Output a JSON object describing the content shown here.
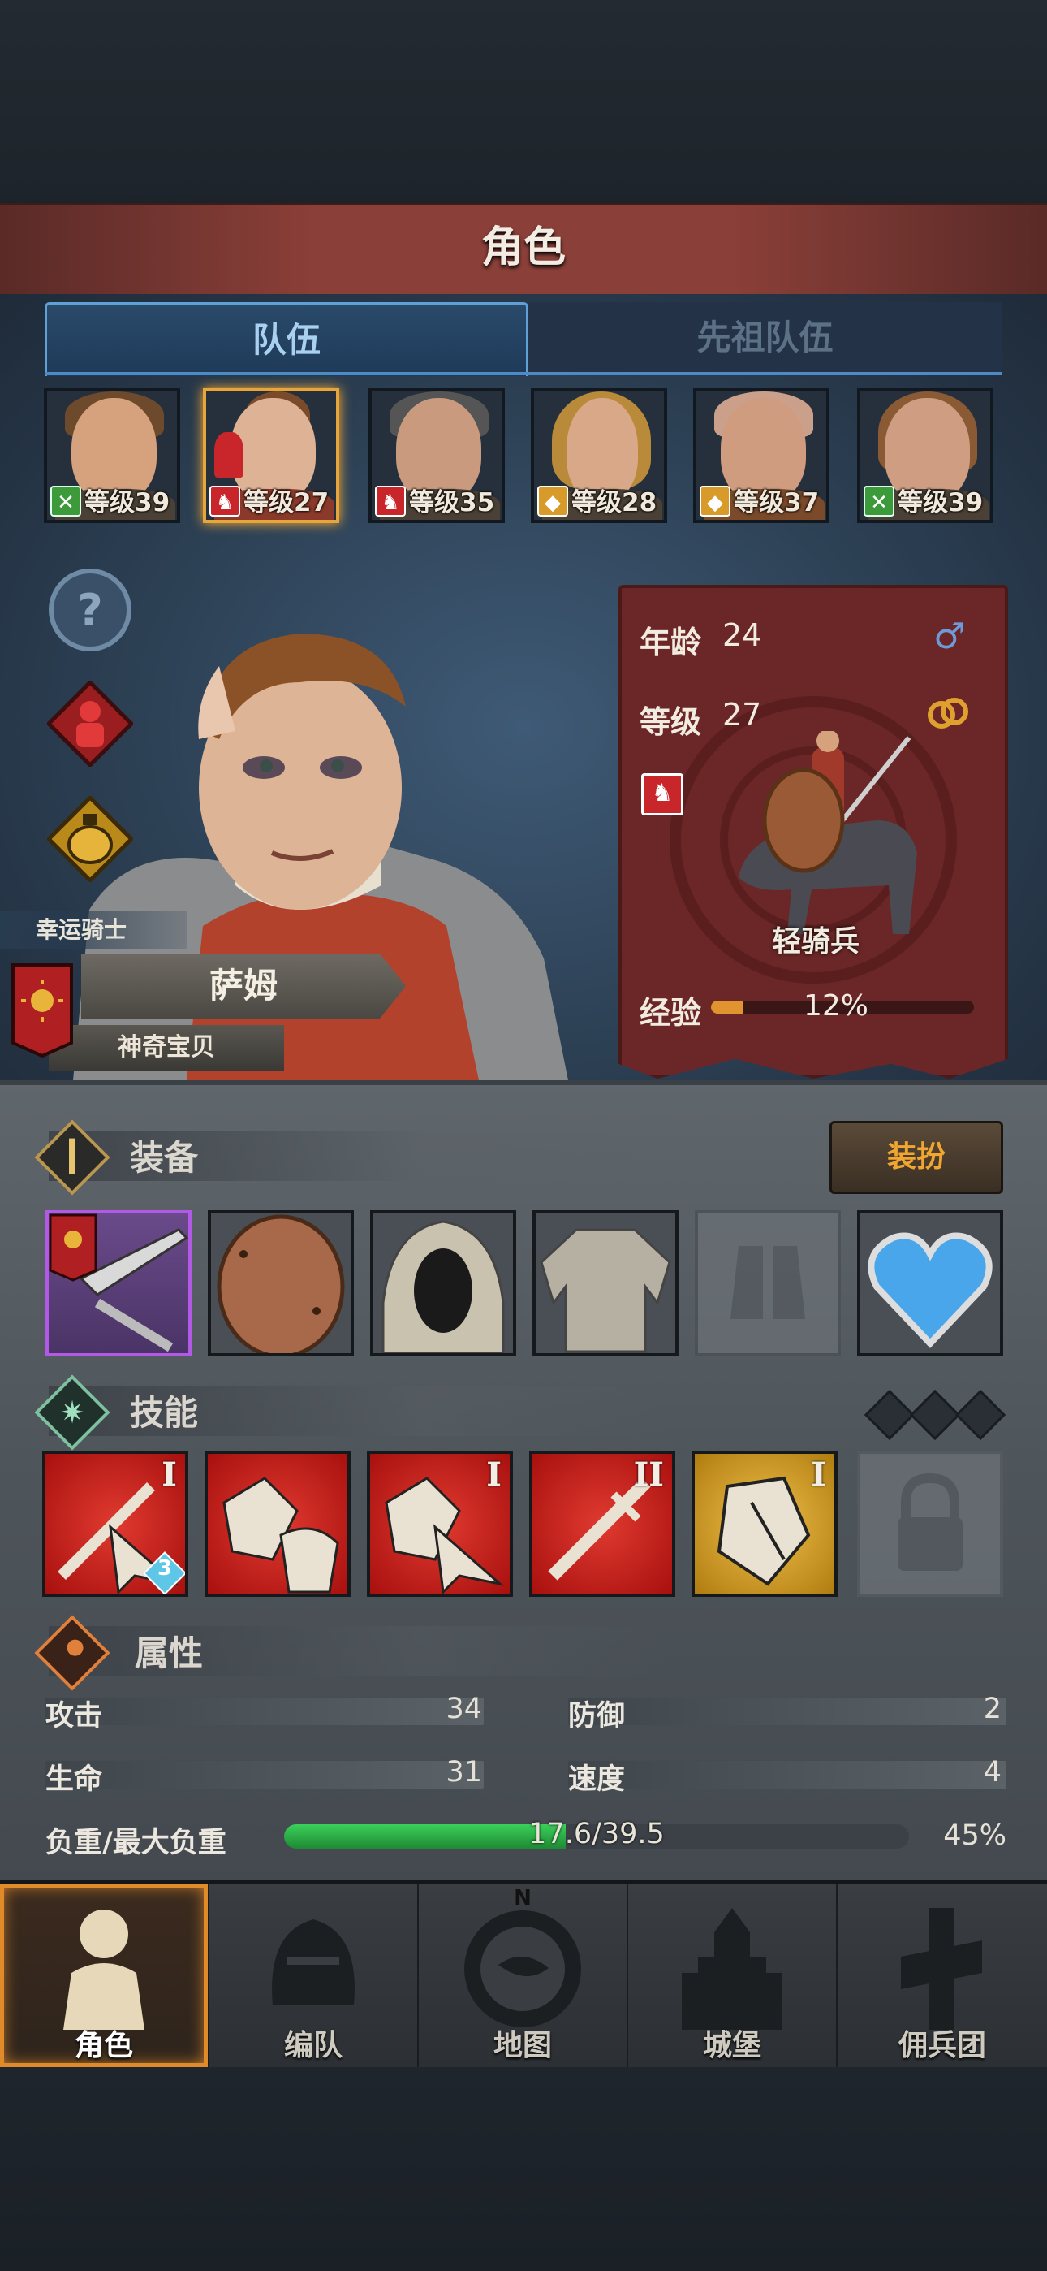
{
  "title": "角色",
  "tabs": [
    {
      "label": "队伍",
      "active": true
    },
    {
      "label": "先祖队伍",
      "active": false
    }
  ],
  "roster": [
    {
      "level_text": "等级39",
      "badge": "archer-icon",
      "hair": "#6e4a2c",
      "skin": "#d6a27e",
      "selected": false
    },
    {
      "level_text": "等级27",
      "badge": "horse-icon",
      "hair": "#7a4b2a",
      "skin": "#ddb295",
      "selected": true
    },
    {
      "level_text": "等级35",
      "badge": "horse-icon",
      "hair": "#555555",
      "skin": "#c99a7e",
      "selected": false
    },
    {
      "level_text": "等级28",
      "badge": "shield-icon",
      "hair": "#b88a3a",
      "skin": "#d8a888",
      "selected": false
    },
    {
      "level_text": "等级37",
      "badge": "shield-icon",
      "hair": "#caa08a",
      "skin": "#cf9c80",
      "selected": false
    },
    {
      "level_text": "等级39",
      "badge": "archer-icon",
      "hair": "#8a5a34",
      "skin": "#cf9e82",
      "selected": false
    }
  ],
  "hero": {
    "class_label": "幸运骑士",
    "name": "萨姆",
    "nickname": "神奇宝贝"
  },
  "info": {
    "age_label": "年龄",
    "age_value": "24",
    "level_label": "等级",
    "level_value": "27",
    "unit_label": "轻骑兵",
    "exp_label": "经验",
    "exp_percent_text": "12%",
    "exp_fraction": 0.12
  },
  "equipment": {
    "title": "装备",
    "outfit_button": "装扮",
    "slots": [
      "lance",
      "round-shield",
      "hood",
      "chainmail",
      "empty-boots",
      "heart-amulet"
    ]
  },
  "skills": {
    "title": "技能",
    "items": [
      {
        "kind": "sword-pierce",
        "rank": "I",
        "color": "red",
        "badge": "3"
      },
      {
        "kind": "shield-horse",
        "rank": "",
        "color": "red",
        "badge": ""
      },
      {
        "kind": "shield-pierce",
        "rank": "I",
        "color": "red",
        "badge": ""
      },
      {
        "kind": "sword",
        "rank": "II",
        "color": "red",
        "badge": ""
      },
      {
        "kind": "shield-break",
        "rank": "I",
        "color": "gold",
        "badge": ""
      },
      {
        "kind": "locked",
        "rank": "",
        "color": "grey",
        "badge": ""
      }
    ]
  },
  "attributes": {
    "title": "属性",
    "attack_label": "攻击",
    "attack_value": "34",
    "defense_label": "防御",
    "defense_value": "2",
    "hp_label": "生命",
    "hp_value": "31",
    "speed_label": "速度",
    "speed_value": "4",
    "load_label": "负重/最大负重",
    "load_text": "17.6/39.5",
    "load_percent_text": "45%",
    "load_fraction": 0.45
  },
  "nav": [
    {
      "label": "角色",
      "icon": "knight-icon",
      "active": true
    },
    {
      "label": "编队",
      "icon": "helmet-icon",
      "active": false
    },
    {
      "label": "地图",
      "icon": "compass-icon",
      "active": false
    },
    {
      "label": "城堡",
      "icon": "castle-icon",
      "active": false
    },
    {
      "label": "佣兵团",
      "icon": "mercenary-icon",
      "active": false
    }
  ],
  "map_compass_letter": "N",
  "colors": {
    "accent": "#e8a53a",
    "tab_blue": "#5fa0d8",
    "card_red": "#6b2627",
    "exp_orange": "#e0932e",
    "load_green": "#2fb347"
  }
}
